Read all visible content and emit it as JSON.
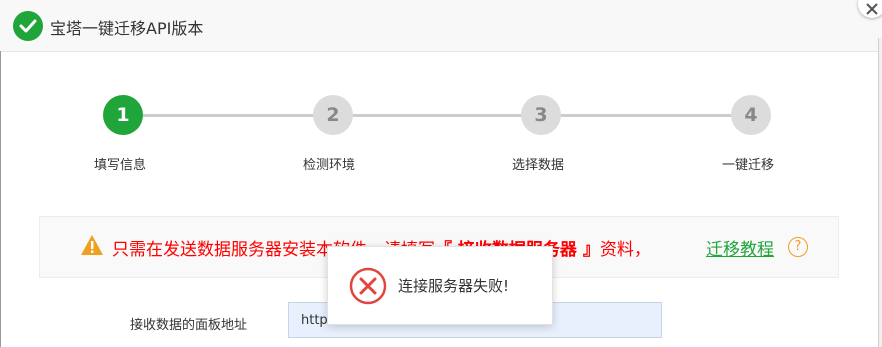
{
  "header": {
    "title": "宝塔一键迁移API版本"
  },
  "steps": [
    {
      "number": "1",
      "label": "填写信息"
    },
    {
      "number": "2",
      "label": "检测环境"
    },
    {
      "number": "3",
      "label": "选择数据"
    },
    {
      "number": "4",
      "label": "一键迁移"
    }
  ],
  "notice": {
    "prefix": "只需在发送数据服务器安装本软件，请填写",
    "highlight": "『 接收数据服务器 』",
    "suffix": "资料，",
    "link_label": "迁移教程",
    "help": "?"
  },
  "form": {
    "panel_url_label": "接收数据的面板地址",
    "panel_url_value": "http://"
  },
  "toast": {
    "message": "连接服务器失败!"
  },
  "colors": {
    "primary": "#20a53a",
    "warning": "#ff0000",
    "help": "#f0a020",
    "error": "#e0463c"
  }
}
